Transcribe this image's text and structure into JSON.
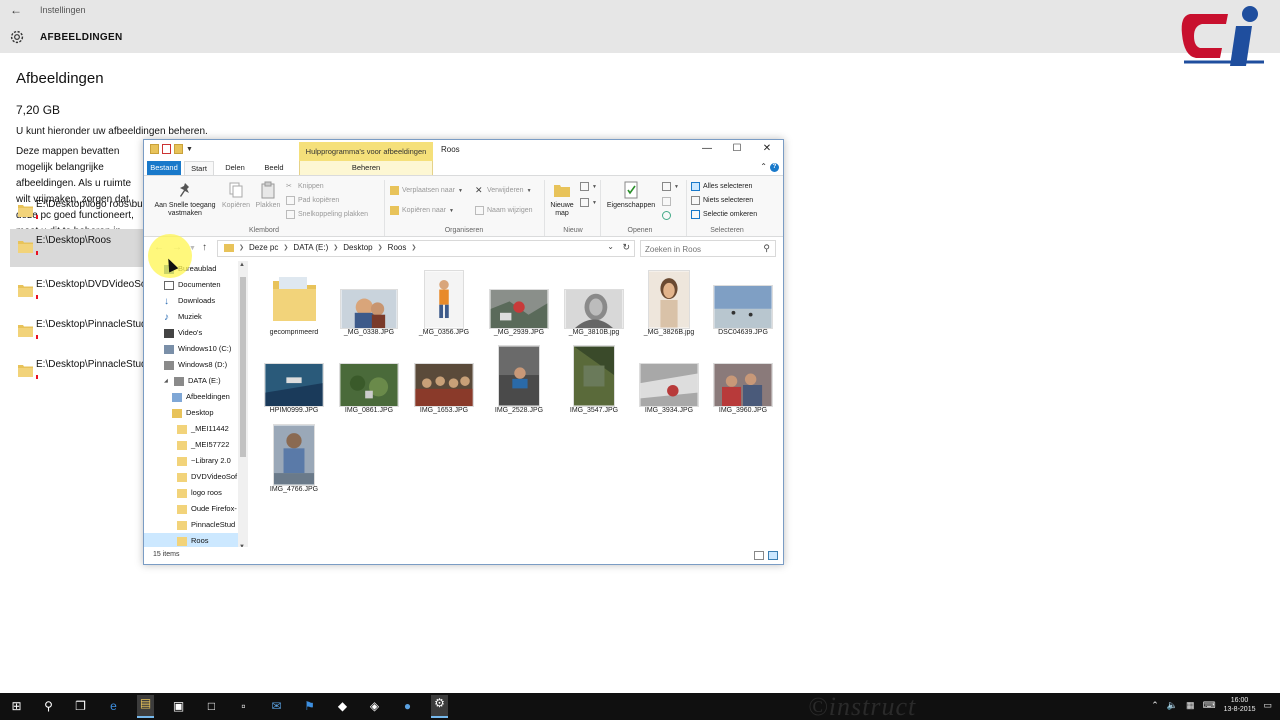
{
  "settings": {
    "app_title": "Instellingen",
    "header_title": "AFBEELDINGEN",
    "page_title": "Afbeeldingen",
    "storage_size": "7,20 GB",
    "description1": "U kunt hieronder uw afbeeldingen beheren.",
    "description2": "Deze mappen bevatten mogelijk belangrijke afbeeldingen. Als u ruimte wilt vrijmaken, zorgen dat deze pc goed functioneert, moet u dit te beheren in Verkenner.",
    "folders": [
      {
        "path": "E:\\Desktop\\logo roos\\bureaublad"
      },
      {
        "path": "E:\\Desktop\\Roos"
      },
      {
        "path": "E:\\Desktop\\DVDVideoSoft"
      },
      {
        "path": "E:\\Desktop\\PinnacleStudio"
      },
      {
        "path": "E:\\Desktop\\PinnacleStudio"
      }
    ]
  },
  "explorer": {
    "window_title": "Roos",
    "context_tab_header": "Hulpprogramma's voor afbeeldingen",
    "tabs": {
      "file": "Bestand",
      "start": "Start",
      "share": "Delen",
      "view": "Beeld",
      "manage": "Beheren"
    },
    "ribbon": {
      "pin": "Aan Snelle toegang vastmaken",
      "copy": "Kopiëren",
      "paste": "Plakken",
      "cut": "Knippen",
      "copy_path": "Pad kopiëren",
      "paste_shortcut": "Snelkoppeling plakken",
      "move_to": "Verplaatsen naar",
      "copy_to": "Kopiëren naar",
      "delete": "Verwijderen",
      "rename": "Naam wijzigen",
      "new_folder": "Nieuwe map",
      "properties": "Eigenschappen",
      "select_all": "Alles selecteren",
      "select_none": "Niets selecteren",
      "invert_selection": "Selectie omkeren",
      "groups": {
        "clipboard": "Klembord",
        "organize": "Organiseren",
        "new": "Nieuw",
        "open": "Openen",
        "select": "Selecteren"
      }
    },
    "address": [
      "Deze pc",
      "DATA (E:)",
      "Desktop",
      "Roos"
    ],
    "search_placeholder": "Zoeken in Roos",
    "nav": [
      "Bureaublad",
      "Documenten",
      "Downloads",
      "Muziek",
      "Video's",
      "Windows10 (C:)",
      "Windows8 (D:)",
      "DATA (E:)",
      "Afbeeldingen",
      "Desktop",
      "_MEI11442",
      "_MEI57722",
      "~Library 2.0",
      "DVDVideoSof",
      "logo roos",
      "Oude Firefox-",
      "PinnacleStud",
      "Roos"
    ],
    "files": [
      {
        "name": "gecomprimeerd",
        "kind": "folder"
      },
      {
        "name": "_MG_0338.JPG",
        "kind": "photo"
      },
      {
        "name": "_MG_0356.JPG",
        "kind": "photo"
      },
      {
        "name": "_MG_2939.JPG",
        "kind": "photo"
      },
      {
        "name": "_MG_3810B.jpg",
        "kind": "photo"
      },
      {
        "name": "_MG_3826B.jpg",
        "kind": "photo"
      },
      {
        "name": "DSC04639.JPG",
        "kind": "photo"
      },
      {
        "name": "HPIM0999.JPG",
        "kind": "photo"
      },
      {
        "name": "IMG_0861.JPG",
        "kind": "photo"
      },
      {
        "name": "IMG_1653.JPG",
        "kind": "photo"
      },
      {
        "name": "IMG_2528.JPG",
        "kind": "photo"
      },
      {
        "name": "IMG_3547.JPG",
        "kind": "photo"
      },
      {
        "name": "IMG_3934.JPG",
        "kind": "photo"
      },
      {
        "name": "IMG_3960.JPG",
        "kind": "photo"
      },
      {
        "name": "IMG_4766.JPG",
        "kind": "photo"
      }
    ],
    "status": "15 items"
  },
  "taskbar": {
    "watermark": "©instruct",
    "time": "16:00",
    "date": "13-8-2015"
  },
  "colors": {
    "accent": "#1979ca",
    "context_tab": "#f5e07a",
    "selection": "#cce8ff",
    "taskbar": "#101010",
    "logo_red": "#c8102e",
    "logo_blue": "#1f4e9e"
  }
}
